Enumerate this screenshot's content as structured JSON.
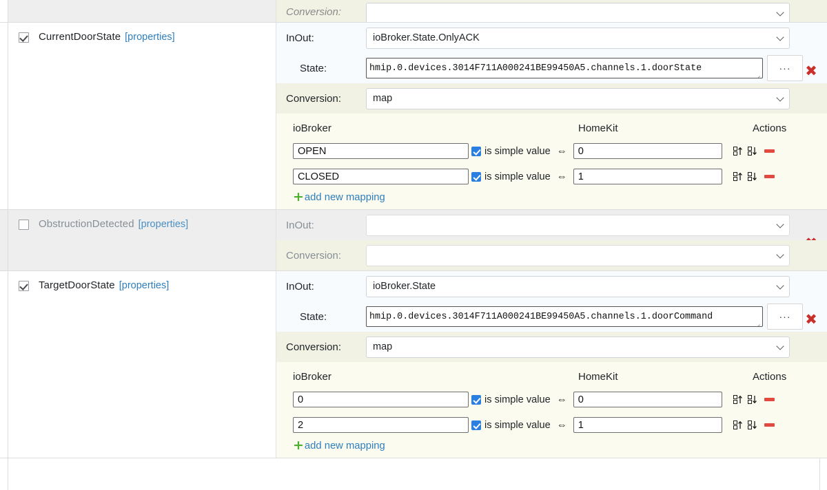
{
  "top_partial_block": {
    "conversion_label": "Conversion:",
    "conversion_value": ""
  },
  "characteristics": [
    {
      "id": "current-door-state",
      "enabled": true,
      "checkbox_state": "checked",
      "name": "CurrentDoorState",
      "properties_link": "[properties]",
      "inout_label": "InOut:",
      "inout_value": "ioBroker.State.OnlyACK",
      "state_label": "State:",
      "state_value": "hmip.0.devices.3014F711A000241BE99450A5.channels.1.doorState",
      "browse_button": "···",
      "delete_icon": "✖",
      "conversion_label": "Conversion:",
      "conversion_value": "map",
      "mapping": {
        "col_iobroker": "ioBroker",
        "col_homekit": "HomeKit",
        "col_actions": "Actions",
        "simple_label": "is simple value",
        "arrow": "⇔",
        "add_label": "add new mapping",
        "add_icon": "+",
        "rows": [
          {
            "iobroker": "OPEN",
            "simple": true,
            "homekit": "0"
          },
          {
            "iobroker": "CLOSED",
            "simple": true,
            "homekit": "1"
          }
        ]
      }
    },
    {
      "id": "obstruction-detected",
      "enabled": false,
      "checkbox_state": "unchecked",
      "name": "ObstructionDetected",
      "properties_link": "[properties]",
      "inout_label": "InOut:",
      "inout_value": "",
      "delete_icon": "✖",
      "conversion_label": "Conversion:",
      "conversion_value": ""
    },
    {
      "id": "target-door-state",
      "enabled": true,
      "checkbox_state": "checked",
      "name": "TargetDoorState",
      "properties_link": "[properties]",
      "inout_label": "InOut:",
      "inout_value": "ioBroker.State",
      "state_label": "State:",
      "state_value": "hmip.0.devices.3014F711A000241BE99450A5.channels.1.doorCommand",
      "browse_button": "···",
      "delete_icon": "✖",
      "conversion_label": "Conversion:",
      "conversion_value": "map",
      "mapping": {
        "col_iobroker": "ioBroker",
        "col_homekit": "HomeKit",
        "col_actions": "Actions",
        "simple_label": "is simple value",
        "arrow": "⇔",
        "add_label": "add new mapping",
        "add_icon": "+",
        "rows": [
          {
            "iobroker": "0",
            "simple": true,
            "homekit": "0"
          },
          {
            "iobroker": "2",
            "simple": true,
            "homekit": "1"
          }
        ]
      }
    }
  ],
  "icons": {
    "sort_up": "sort-ascending-icon",
    "sort_down": "sort-descending-icon",
    "remove": "remove-row-icon",
    "caret": "chevron-down-icon",
    "resize_grip": "resize-grip-icon"
  },
  "colors": {
    "link": "#2f7fbf",
    "delete_red": "#c9302c",
    "minus_red": "#e04a40",
    "plus_green": "#4caf2f",
    "checkbox_blue": "#2b7fe0",
    "row_blue_bg": "#f7fbfe",
    "row_yellow_bg": "#f2f2e4",
    "row_yellow_body_bg": "#fbfbef",
    "disabled_bg": "#eeeeee"
  }
}
